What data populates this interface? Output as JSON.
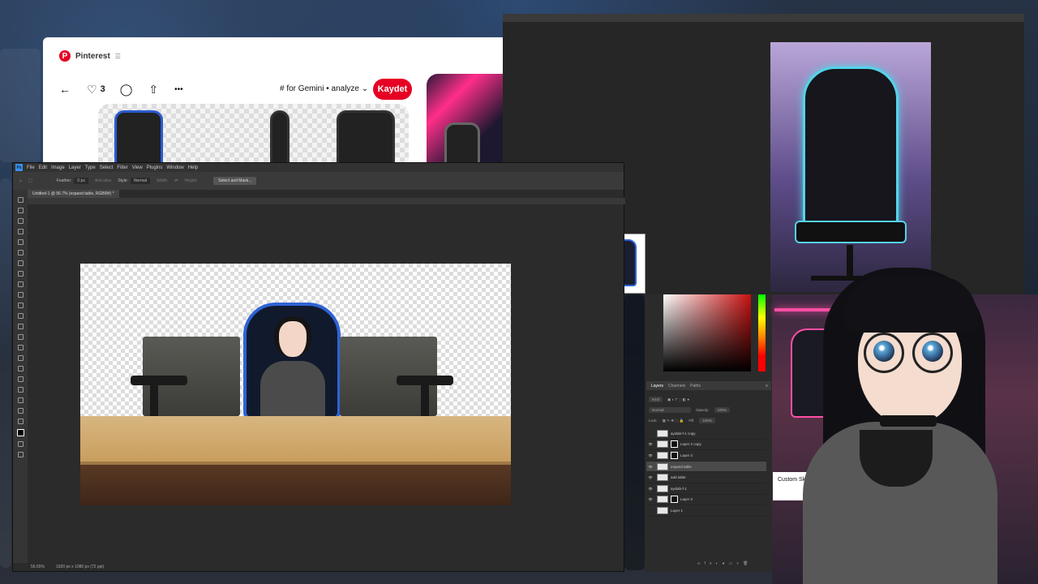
{
  "pinterest": {
    "title": "Pinterest",
    "likes": "3",
    "board": "# for Gemini • analyze",
    "save_label": "Kaydet"
  },
  "photoshop": {
    "menu": [
      "File",
      "Edit",
      "Image",
      "Layer",
      "Type",
      "Select",
      "Filter",
      "View",
      "Plugins",
      "Window",
      "Help"
    ],
    "options": {
      "feather_label": "Feather:",
      "feather_value": "0 px",
      "antialias": "Anti-alias",
      "style_label": "Style:",
      "style_value": "Normal",
      "width_label": "Width:",
      "height_label": "Height:",
      "select_mask": "Select and Mask..."
    },
    "document_tab": "Untitled-1 @ 56.7% (expand table, RGB/8#) *",
    "status_zoom": "56.65%",
    "status_size": "1920 px x 1080 px (72 ppi)"
  },
  "layers_panel": {
    "tabs": [
      "Layers",
      "Channels",
      "Paths"
    ],
    "kind_label": "Kind",
    "blend_mode": "Normal",
    "opacity_label": "Opacity:",
    "opacity_value": "100%",
    "lock_label": "Lock:",
    "fill_label": "Fill:",
    "fill_value": "100%",
    "layers": [
      {
        "name": "ayslab-f-1 copy",
        "visible": false,
        "mask": false,
        "active": false
      },
      {
        "name": "Layer 2 copy",
        "visible": true,
        "mask": true,
        "active": false
      },
      {
        "name": "Layer 2",
        "visible": true,
        "mask": true,
        "active": false
      },
      {
        "name": "expand table",
        "visible": true,
        "mask": false,
        "active": true
      },
      {
        "name": "add table",
        "visible": true,
        "mask": false,
        "active": false
      },
      {
        "name": "ayslab-f-1",
        "visible": true,
        "mask": false,
        "active": false
      },
      {
        "name": "Layer 3",
        "visible": true,
        "mask": true,
        "active": false
      },
      {
        "name": "Layer 1",
        "visible": false,
        "mask": false,
        "active": false
      }
    ]
  },
  "overlay": {
    "custom_label": "Custom Sk"
  },
  "icons": {
    "back": "←",
    "heart": "♡",
    "comment": "◯",
    "share": "⇧",
    "more": "•••",
    "chevron": "⌄",
    "eye": "👁"
  },
  "colors": {
    "pinterest_red": "#e60023",
    "ps_blue": "#3a8ee6",
    "chair_accent": "#2d63d6"
  }
}
